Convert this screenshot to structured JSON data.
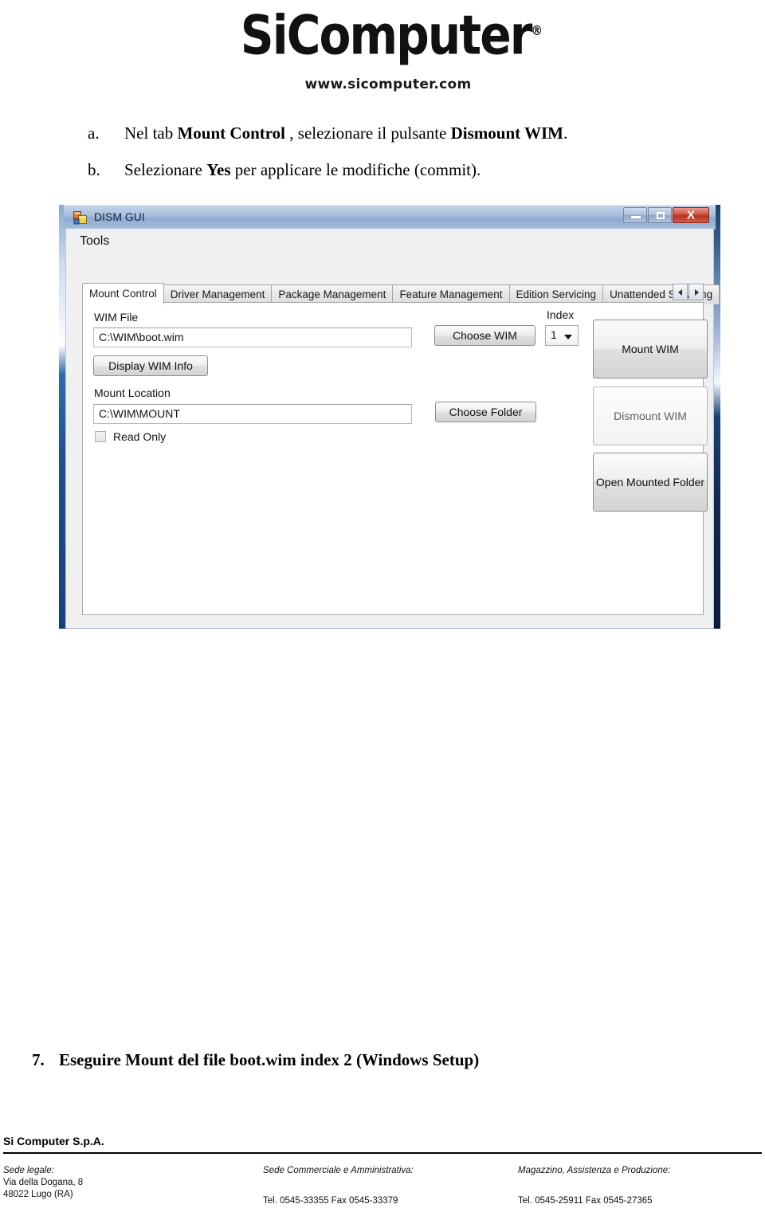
{
  "header": {
    "logo_text": "SiComputer",
    "logo_trademark": "®",
    "logo_dot": ".",
    "website": "www.sicomputer.com"
  },
  "steps": [
    {
      "marker": "a.",
      "segments": [
        {
          "text": "Nel tab ",
          "bold": false
        },
        {
          "text": "Mount Control",
          "bold": true
        },
        {
          "text": " , selezionare il pulsante ",
          "bold": false
        },
        {
          "text": "Dismount WIM",
          "bold": true
        },
        {
          "text": ".",
          "bold": false
        }
      ],
      "plain": "Nel tab Mount Control , selezionare il pulsante Dismount WIM."
    },
    {
      "marker": "b.",
      "segments": [
        {
          "text": "Selezionare ",
          "bold": false
        },
        {
          "text": "Yes",
          "bold": true
        },
        {
          "text": " per applicare le modifiche (commit).",
          "bold": false
        }
      ],
      "plain": "Selezionare Yes per applicare le modifiche (commit)."
    }
  ],
  "window": {
    "title": "DISM GUI",
    "icon": "vb-form-icon",
    "buttons": {
      "minimize": "minimize-icon",
      "maximize": "maximize-icon",
      "close": "X"
    },
    "menu": [
      "Tools"
    ],
    "tabs": [
      {
        "label": "Mount Control",
        "active": true
      },
      {
        "label": "Driver Management",
        "active": false
      },
      {
        "label": "Package Management",
        "active": false
      },
      {
        "label": "Feature Management",
        "active": false
      },
      {
        "label": "Edition Servicing",
        "active": false
      },
      {
        "label": "Unattended Servicing",
        "active": false
      }
    ],
    "tab_scroll": {
      "left": "chevron-left-icon",
      "right": "chevron-right-icon"
    },
    "panel": {
      "wim_file_label": "WIM File",
      "wim_file_value": "C:\\WIM\\boot.wim",
      "display_wim_info_label": "Display WIM Info",
      "choose_wim_label": "Choose WIM",
      "index_label": "Index",
      "index_value": "1",
      "mount_wim_label": "Mount WIM",
      "mount_location_label": "Mount Location",
      "mount_location_value": "C:\\WIM\\MOUNT",
      "read_only_label": "Read Only",
      "read_only_checked": false,
      "choose_folder_label": "Choose Folder",
      "dismount_wim_label": "Dismount WIM",
      "dismount_wim_disabled": true,
      "open_mounted_folder_label": "Open Mounted Folder"
    }
  },
  "step7": {
    "number": "7.",
    "text": "Eseguire Mount del file boot.wim  index 2 (Windows Setup)"
  },
  "footer": {
    "company": "Si Computer S.p.A.",
    "col1": {
      "heading": "Sede legale:",
      "line1": "Via della Dogana, 8",
      "line2": "48022 Lugo (RA)"
    },
    "col2": {
      "heading": "Sede Commerciale e Amministrativa:",
      "tel": "Tel. 0545-33355 Fax 0545-33379"
    },
    "col3": {
      "heading": "Magazzino, Assistenza e Produzione:",
      "tel": "Tel. 0545-25911 Fax 0545-27365"
    }
  },
  "colors": {
    "close_button": "#c0392b",
    "title_bar": "#a9c0dd",
    "glass_edge": "#1d4f93"
  }
}
